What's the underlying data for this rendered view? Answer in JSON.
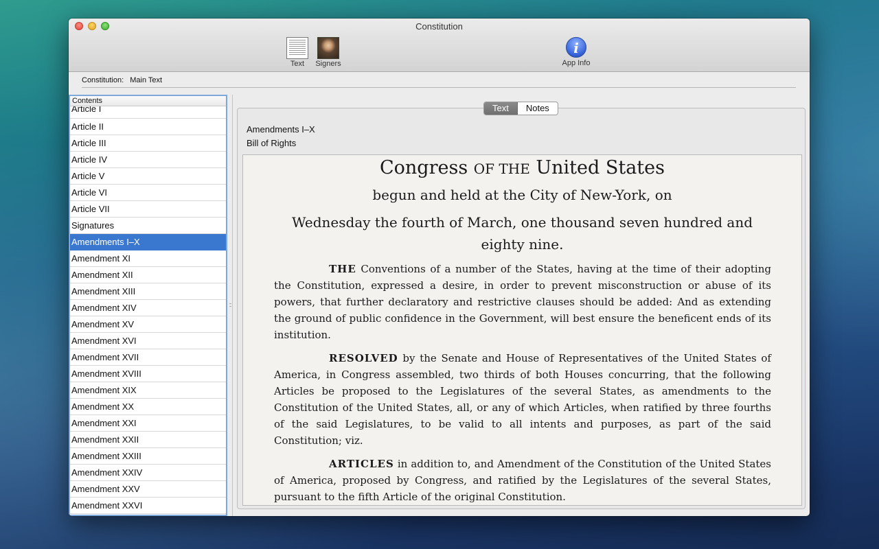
{
  "window": {
    "title": "Constitution"
  },
  "toolbar": {
    "text_label": "Text",
    "signers_label": "Signers",
    "appinfo_label": "App Info"
  },
  "breadcrumb": {
    "label": "Constitution:",
    "value": "Main Text"
  },
  "sidebar": {
    "header": "Contents",
    "items": [
      "Article I",
      "Article II",
      "Article III",
      "Article IV",
      "Article V",
      "Article VI",
      "Article VII",
      "Signatures",
      "Amendments I–X",
      "Amendment XI",
      "Amendment XII",
      "Amendment XIII",
      "Amendment XIV",
      "Amendment XV",
      "Amendment XVI",
      "Amendment XVII",
      "Amendment XVIII",
      "Amendment XIX",
      "Amendment XX",
      "Amendment XXI",
      "Amendment XXII",
      "Amendment XXIII",
      "Amendment XXIV",
      "Amendment XXV",
      "Amendment XXVI"
    ],
    "selected": "Amendments I–X"
  },
  "tabs": {
    "text": "Text",
    "notes": "Notes",
    "active": "Text"
  },
  "panel": {
    "line1": "Amendments I–X",
    "line2": "Bill of Rights"
  },
  "document": {
    "title_a": "Congress",
    "title_b": "OF THE",
    "title_c": "United States",
    "subtitle": "begun and held at the City of New-York, on",
    "date": "Wednesday the fourth of March, one thousand seven hundred and eighty nine.",
    "p1_lead": "THE",
    "p1": "Conventions of a number of the States, having at the time of their adopting the Constitution, expressed a desire, in order to prevent misconstruction or abuse of its powers, that further declaratory and restrictive clauses should be added: And as extending the ground of public confidence in the Government, will best ensure the beneficent ends of its institution.",
    "p2_lead": "RESOLVED",
    "p2": "by the Senate and House of Representatives of the United States of America, in Congress assembled, two thirds of both Houses concurring, that the following Articles be proposed to the Legislatures of the several States, as amendments to the Constitution of the United States, all, or any of which Articles, when ratified by three fourths of the said Legislatures, to be valid to all intents and purposes, as part of the said Constitution; viz.",
    "p3_lead": "ARTICLES",
    "p3": "in addition to, and Amendment of the Constitution of the United States of America, proposed by Congress, and ratified by the Legislatures of the several States, pursuant to the fifth Article of the original Constitution."
  }
}
